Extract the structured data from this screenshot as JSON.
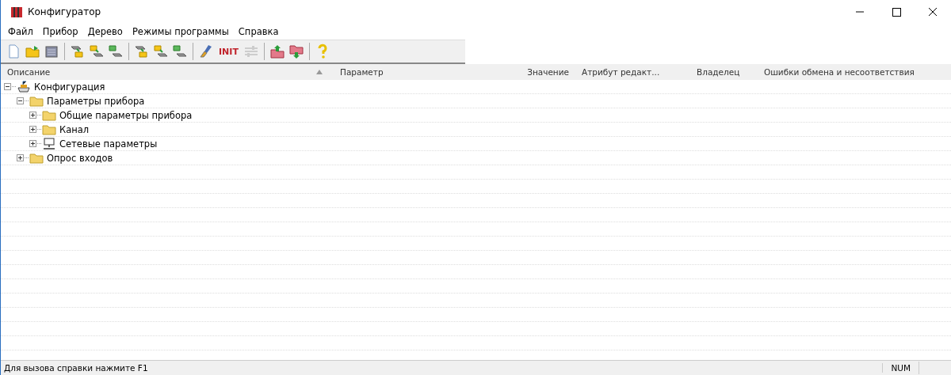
{
  "window": {
    "title": "Конфигуратор"
  },
  "menu": [
    "Файл",
    "Прибор",
    "Дерево",
    "Режимы программы",
    "Справка"
  ],
  "toolbar": [
    [
      {
        "kind": "page"
      },
      {
        "kind": "folder"
      },
      {
        "kind": "chip"
      }
    ],
    [
      {
        "kind": "grey-to-yellow"
      },
      {
        "kind": "yellow-to-grey"
      },
      {
        "kind": "green-to-grey"
      }
    ],
    [
      {
        "kind": "grey-to-yellow"
      },
      {
        "kind": "yellow-to-grey"
      },
      {
        "kind": "green-to-grey"
      }
    ],
    [
      {
        "kind": "brush"
      },
      {
        "kind": "text",
        "label": "INIT"
      },
      {
        "kind": "sliders"
      }
    ],
    [
      {
        "kind": "upload"
      },
      {
        "kind": "download"
      }
    ],
    [
      {
        "kind": "help"
      }
    ]
  ],
  "table": {
    "columns": [
      {
        "label": "Описание",
        "sorted": true
      },
      {
        "label": "Параметр",
        "sorted": false
      },
      {
        "label": "Значение",
        "sorted": false
      },
      {
        "label": "Атрибут редакт...",
        "sorted": false
      },
      {
        "label": "Владелец",
        "sorted": false
      },
      {
        "label": "Ошибки обмена и несоответствия",
        "sorted": false
      }
    ],
    "tree": [
      {
        "label": "Конфигурация",
        "kind": "config",
        "expanded": true,
        "children": [
          {
            "label": "Параметры прибора",
            "kind": "folder",
            "expanded": true,
            "children": [
              {
                "label": "Общие параметры прибора",
                "kind": "folder",
                "expanded": false
              },
              {
                "label": "Канал",
                "kind": "folder",
                "expanded": false
              },
              {
                "label": "Сетевые параметры",
                "kind": "network",
                "expanded": false
              }
            ]
          },
          {
            "label": "Опрос входов",
            "kind": "folder",
            "expanded": false
          }
        ]
      }
    ]
  },
  "status_bar": {
    "text": "Для вызова справки нажмите F1",
    "indicator": "NUM"
  }
}
